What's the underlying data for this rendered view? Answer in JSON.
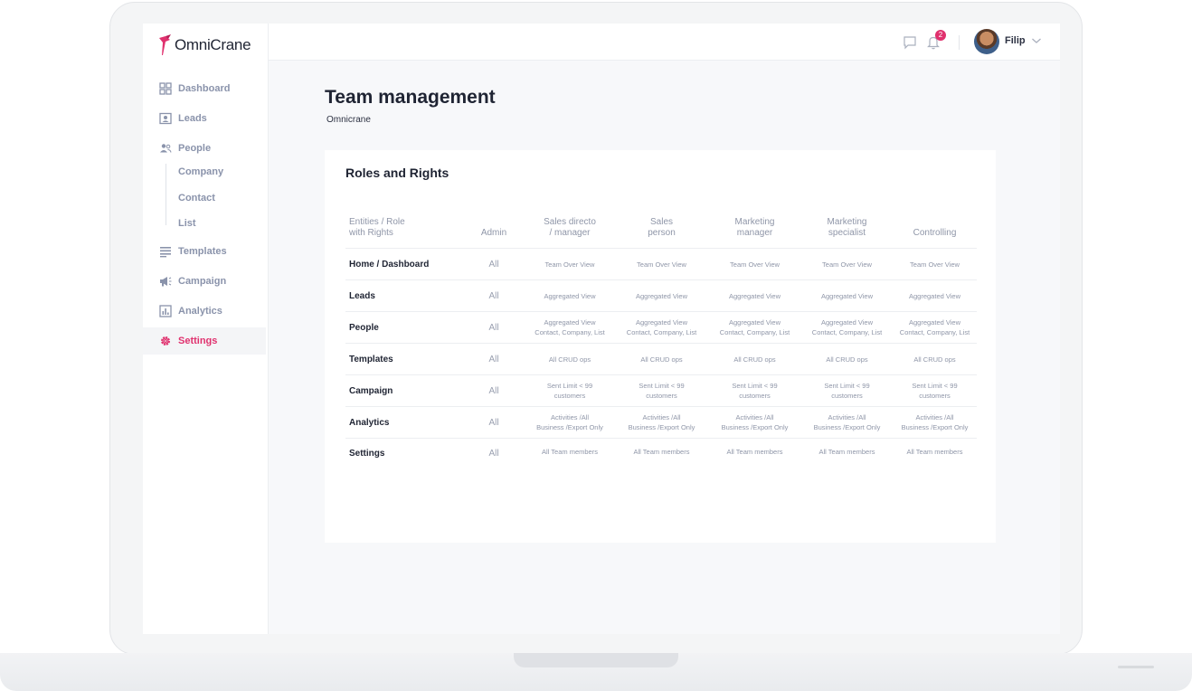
{
  "app": {
    "logo_text": "OmniCrane",
    "brand_color": "#e0316e"
  },
  "sidebar": {
    "items": [
      {
        "label": "Dashboard",
        "icon": "dashboard-grid-icon"
      },
      {
        "label": "Leads",
        "icon": "id-card-icon"
      },
      {
        "label": "People",
        "icon": "people-icon"
      },
      {
        "label": "Templates",
        "icon": "list-lines-icon"
      },
      {
        "label": "Campaign",
        "icon": "megaphone-icon"
      },
      {
        "label": "Analytics",
        "icon": "bar-chart-icon"
      },
      {
        "label": "Settings",
        "icon": "gear-icon",
        "active": true
      }
    ],
    "people_subitems": [
      "Company",
      "Contact",
      "List"
    ]
  },
  "topbar": {
    "notification_count": "2",
    "user_name": "Filip"
  },
  "page": {
    "title": "Team management",
    "subtitle": "Omnicrane"
  },
  "card": {
    "title": "Roles and Rights",
    "table": {
      "headers": [
        "Entities / Role\nwith Rights",
        "Admin",
        "Sales  directo\n/ manager",
        "Sales\nperson",
        "Marketing\nmanager",
        "Marketing\nspecialist",
        "Controlling"
      ],
      "rows": [
        {
          "entity": "Home / Dashboard",
          "admin": "All",
          "cells": [
            "Team Over View",
            "Team Over View",
            "Team Over View",
            "Team Over View",
            "Team Over View"
          ]
        },
        {
          "entity": "Leads",
          "admin": "All",
          "cells": [
            "Aggregated View",
            "Aggregated View",
            "Aggregated View",
            "Aggregated View",
            "Aggregated View"
          ]
        },
        {
          "entity": "People",
          "admin": "All",
          "cells": [
            "Aggregated View\nContact, Company, List",
            "Aggregated View\nContact, Company, List",
            "Aggregated View\nContact, Company, List",
            "Aggregated View\nContact, Company, List",
            "Aggregated View\nContact, Company, List"
          ]
        },
        {
          "entity": "Templates",
          "admin": "All",
          "cells": [
            "All CRUD ops",
            "All CRUD ops",
            "All CRUD ops",
            "All CRUD ops",
            "All CRUD ops"
          ]
        },
        {
          "entity": "Campaign",
          "admin": "All",
          "cells": [
            "Sent Limit < 99\ncustomers",
            "Sent Limit < 99\ncustomers",
            "Sent Limit < 99\ncustomers",
            "Sent Limit < 99\ncustomers",
            "Sent Limit < 99\ncustomers"
          ]
        },
        {
          "entity": "Analytics",
          "admin": "All",
          "cells": [
            "Activities /All\nBusiness /Export Only",
            "Activities /All\nBusiness /Export Only",
            "Activities /All\nBusiness /Export Only",
            "Activities /All\nBusiness /Export Only",
            "Activities /All\nBusiness /Export Only"
          ]
        },
        {
          "entity": "Settings",
          "admin": "All",
          "cells": [
            "All Team members",
            "All Team members",
            "All Team members",
            "All Team members",
            "All Team members"
          ]
        }
      ]
    }
  }
}
